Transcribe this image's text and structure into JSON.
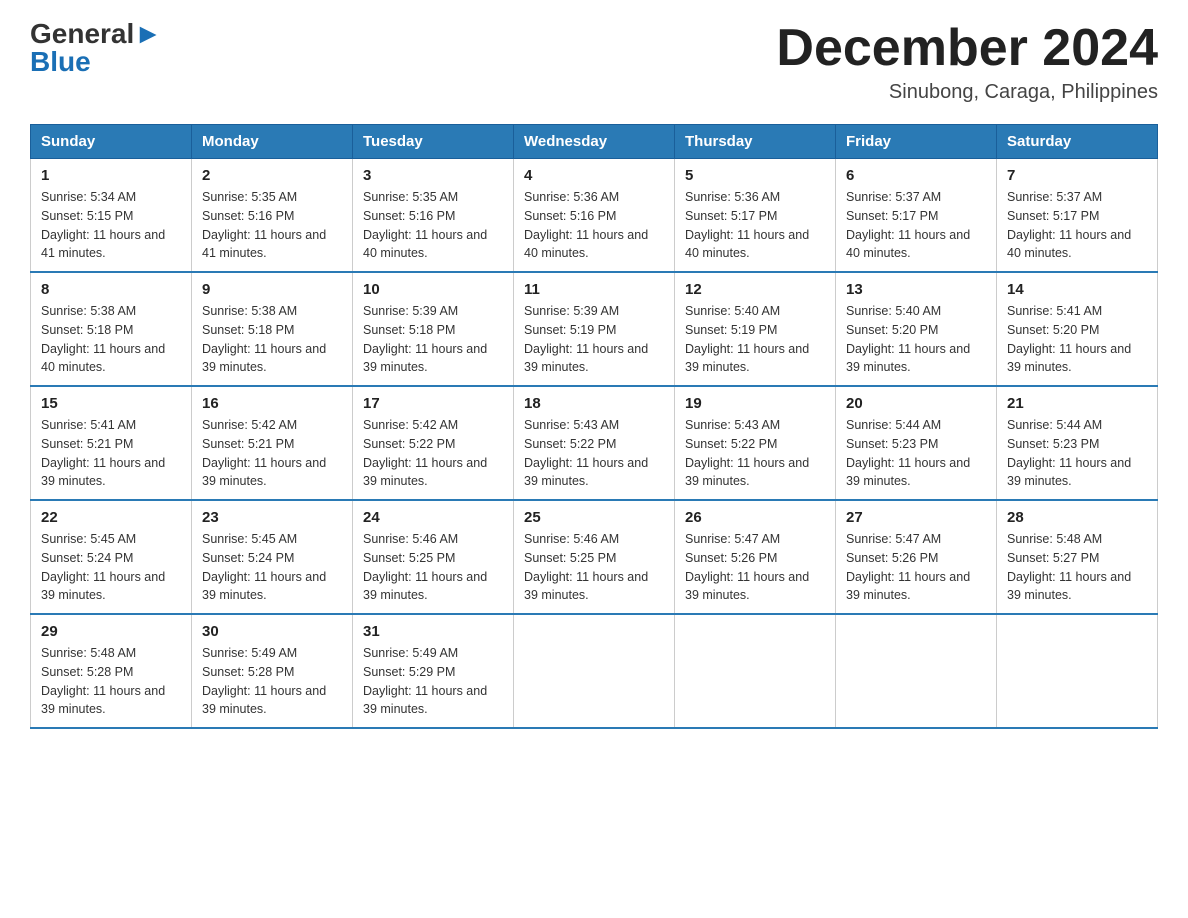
{
  "header": {
    "logo_general": "General",
    "logo_blue": "Blue",
    "month_title": "December 2024",
    "location": "Sinubong, Caraga, Philippines"
  },
  "days_of_week": [
    "Sunday",
    "Monday",
    "Tuesday",
    "Wednesday",
    "Thursday",
    "Friday",
    "Saturday"
  ],
  "weeks": [
    [
      {
        "day": "1",
        "sunrise": "5:34 AM",
        "sunset": "5:15 PM",
        "daylight": "11 hours and 41 minutes."
      },
      {
        "day": "2",
        "sunrise": "5:35 AM",
        "sunset": "5:16 PM",
        "daylight": "11 hours and 41 minutes."
      },
      {
        "day": "3",
        "sunrise": "5:35 AM",
        "sunset": "5:16 PM",
        "daylight": "11 hours and 40 minutes."
      },
      {
        "day": "4",
        "sunrise": "5:36 AM",
        "sunset": "5:16 PM",
        "daylight": "11 hours and 40 minutes."
      },
      {
        "day": "5",
        "sunrise": "5:36 AM",
        "sunset": "5:17 PM",
        "daylight": "11 hours and 40 minutes."
      },
      {
        "day": "6",
        "sunrise": "5:37 AM",
        "sunset": "5:17 PM",
        "daylight": "11 hours and 40 minutes."
      },
      {
        "day": "7",
        "sunrise": "5:37 AM",
        "sunset": "5:17 PM",
        "daylight": "11 hours and 40 minutes."
      }
    ],
    [
      {
        "day": "8",
        "sunrise": "5:38 AM",
        "sunset": "5:18 PM",
        "daylight": "11 hours and 40 minutes."
      },
      {
        "day": "9",
        "sunrise": "5:38 AM",
        "sunset": "5:18 PM",
        "daylight": "11 hours and 39 minutes."
      },
      {
        "day": "10",
        "sunrise": "5:39 AM",
        "sunset": "5:18 PM",
        "daylight": "11 hours and 39 minutes."
      },
      {
        "day": "11",
        "sunrise": "5:39 AM",
        "sunset": "5:19 PM",
        "daylight": "11 hours and 39 minutes."
      },
      {
        "day": "12",
        "sunrise": "5:40 AM",
        "sunset": "5:19 PM",
        "daylight": "11 hours and 39 minutes."
      },
      {
        "day": "13",
        "sunrise": "5:40 AM",
        "sunset": "5:20 PM",
        "daylight": "11 hours and 39 minutes."
      },
      {
        "day": "14",
        "sunrise": "5:41 AM",
        "sunset": "5:20 PM",
        "daylight": "11 hours and 39 minutes."
      }
    ],
    [
      {
        "day": "15",
        "sunrise": "5:41 AM",
        "sunset": "5:21 PM",
        "daylight": "11 hours and 39 minutes."
      },
      {
        "day": "16",
        "sunrise": "5:42 AM",
        "sunset": "5:21 PM",
        "daylight": "11 hours and 39 minutes."
      },
      {
        "day": "17",
        "sunrise": "5:42 AM",
        "sunset": "5:22 PM",
        "daylight": "11 hours and 39 minutes."
      },
      {
        "day": "18",
        "sunrise": "5:43 AM",
        "sunset": "5:22 PM",
        "daylight": "11 hours and 39 minutes."
      },
      {
        "day": "19",
        "sunrise": "5:43 AM",
        "sunset": "5:22 PM",
        "daylight": "11 hours and 39 minutes."
      },
      {
        "day": "20",
        "sunrise": "5:44 AM",
        "sunset": "5:23 PM",
        "daylight": "11 hours and 39 minutes."
      },
      {
        "day": "21",
        "sunrise": "5:44 AM",
        "sunset": "5:23 PM",
        "daylight": "11 hours and 39 minutes."
      }
    ],
    [
      {
        "day": "22",
        "sunrise": "5:45 AM",
        "sunset": "5:24 PM",
        "daylight": "11 hours and 39 minutes."
      },
      {
        "day": "23",
        "sunrise": "5:45 AM",
        "sunset": "5:24 PM",
        "daylight": "11 hours and 39 minutes."
      },
      {
        "day": "24",
        "sunrise": "5:46 AM",
        "sunset": "5:25 PM",
        "daylight": "11 hours and 39 minutes."
      },
      {
        "day": "25",
        "sunrise": "5:46 AM",
        "sunset": "5:25 PM",
        "daylight": "11 hours and 39 minutes."
      },
      {
        "day": "26",
        "sunrise": "5:47 AM",
        "sunset": "5:26 PM",
        "daylight": "11 hours and 39 minutes."
      },
      {
        "day": "27",
        "sunrise": "5:47 AM",
        "sunset": "5:26 PM",
        "daylight": "11 hours and 39 minutes."
      },
      {
        "day": "28",
        "sunrise": "5:48 AM",
        "sunset": "5:27 PM",
        "daylight": "11 hours and 39 minutes."
      }
    ],
    [
      {
        "day": "29",
        "sunrise": "5:48 AM",
        "sunset": "5:28 PM",
        "daylight": "11 hours and 39 minutes."
      },
      {
        "day": "30",
        "sunrise": "5:49 AM",
        "sunset": "5:28 PM",
        "daylight": "11 hours and 39 minutes."
      },
      {
        "day": "31",
        "sunrise": "5:49 AM",
        "sunset": "5:29 PM",
        "daylight": "11 hours and 39 minutes."
      },
      null,
      null,
      null,
      null
    ]
  ]
}
